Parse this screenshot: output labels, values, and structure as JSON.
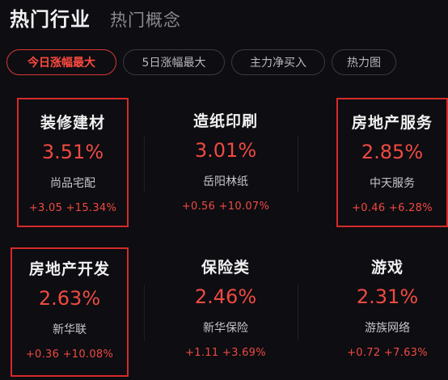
{
  "header": {
    "tab_hot_industry": "热门行业",
    "tab_hot_concept": "热门概念"
  },
  "filters": [
    {
      "label": "今日涨幅最大",
      "active": true
    },
    {
      "label": "5日涨幅最大",
      "active": false
    },
    {
      "label": "主力净买入",
      "active": false
    },
    {
      "label": "热力图",
      "active": false
    }
  ],
  "industries": [
    {
      "name": "装修建材",
      "pct": "3.51%",
      "stock": "尚品宅配",
      "change": "+3.05 +15.34%",
      "highlighted": true
    },
    {
      "name": "造纸印刷",
      "pct": "3.01%",
      "stock": "岳阳林纸",
      "change": "+0.56 +10.07%",
      "highlighted": false
    },
    {
      "name": "房地产服务",
      "pct": "2.85%",
      "stock": "中天服务",
      "change": "+0.46 +6.28%",
      "highlighted": true
    },
    {
      "name": "房地产开发",
      "pct": "2.63%",
      "stock": "新华联",
      "change": "+0.36 +10.08%",
      "highlighted": true
    },
    {
      "name": "保险类",
      "pct": "2.46%",
      "stock": "新华保险",
      "change": "+1.11 +3.69%",
      "highlighted": false
    },
    {
      "name": "游戏",
      "pct": "2.31%",
      "stock": "游族网络",
      "change": "+0.72 +7.63%",
      "highlighted": false
    }
  ],
  "colors": {
    "up": "#f04a40",
    "highlight_border": "#d62a2a",
    "active_chip": "#ff4a3f"
  }
}
